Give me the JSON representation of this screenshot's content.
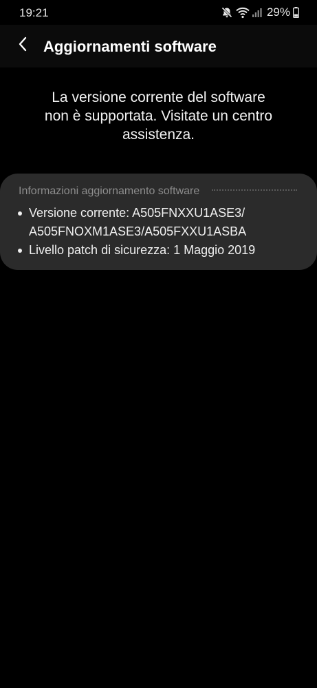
{
  "status_bar": {
    "time": "19:21",
    "battery_percent": "29%",
    "icons": [
      "mute-icon",
      "wifi-icon",
      "signal-icon",
      "battery-icon"
    ]
  },
  "header": {
    "back_icon": "chevron-left-icon",
    "title": "Aggiornamenti software"
  },
  "message": {
    "line1": "La versione corrente del software",
    "line2": "non è supportata. Visitate un centro",
    "line3": "assistenza."
  },
  "info_card": {
    "header": "Informazioni aggiornamento software",
    "items": [
      {
        "line1": "Versione corrente: A505FNXXU1ASE3/",
        "line2": "A505FNOXM1ASE3/A505FXXU1ASBA"
      },
      {
        "line1": "Livello patch di sicurezza: 1 Maggio 2019"
      }
    ]
  },
  "colors": {
    "background": "#000000",
    "app_bar": "#0b0b0b",
    "card": "#2b2b2b",
    "secondary_text": "#8d8d8d"
  }
}
